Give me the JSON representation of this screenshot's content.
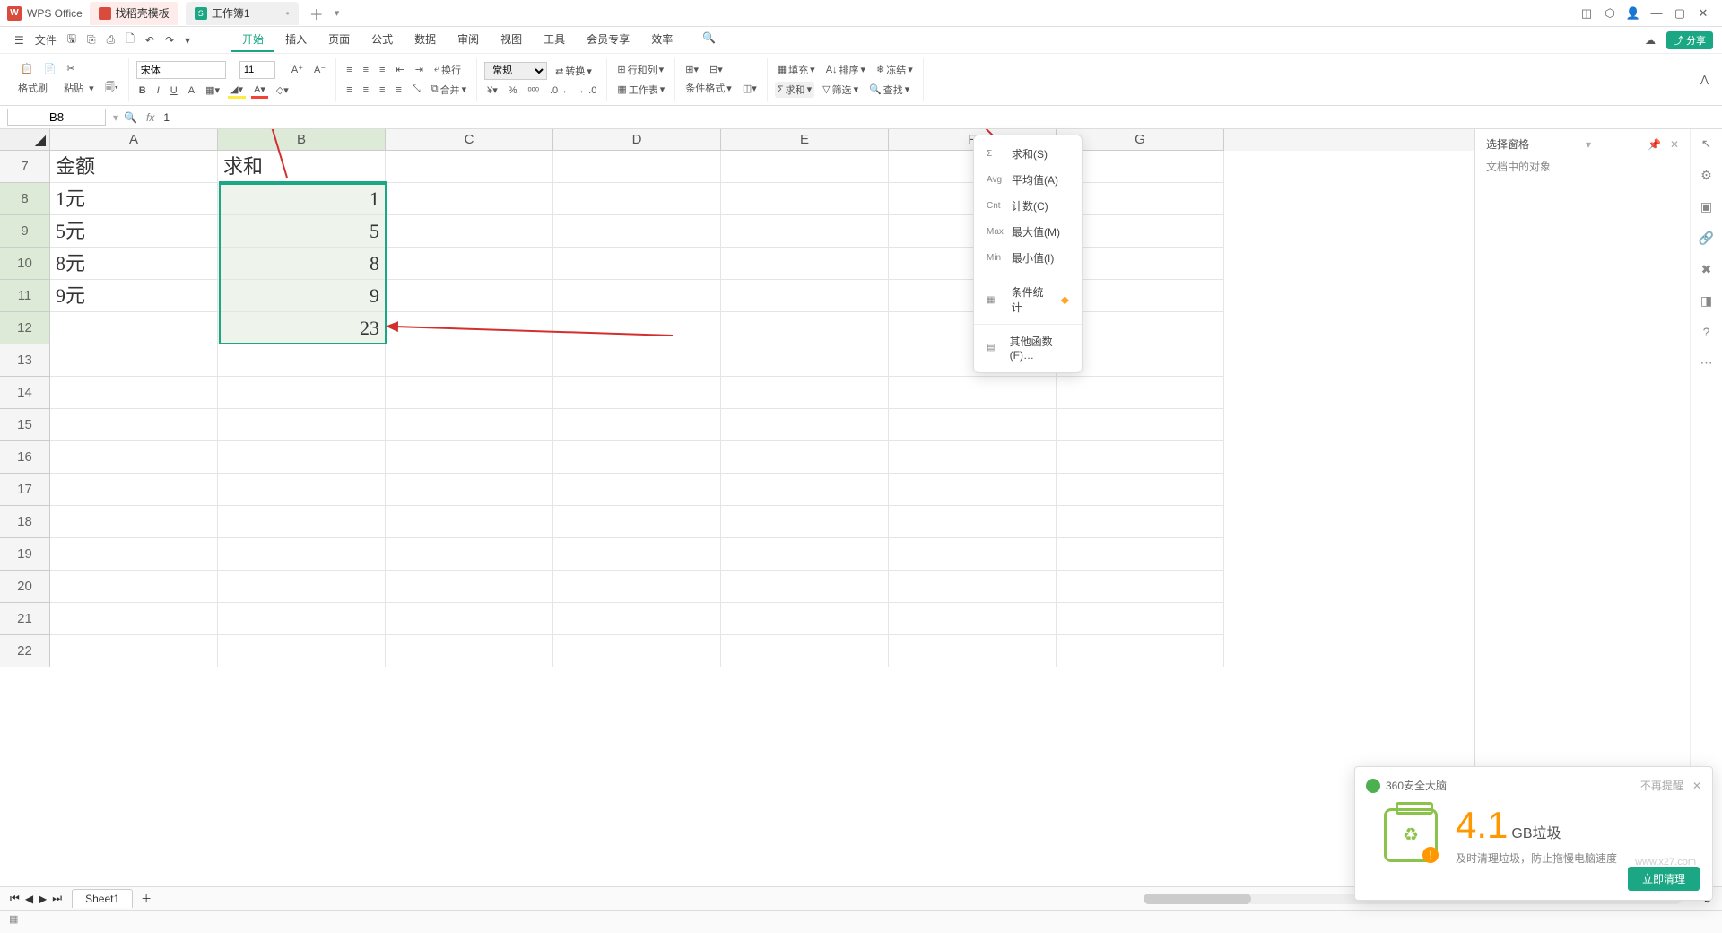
{
  "titlebar": {
    "app": "WPS Office",
    "tab1": "找稻壳模板",
    "tab2": "工作簿1",
    "tab2_icon": "S"
  },
  "menubar": {
    "file": "文件",
    "tabs": [
      "开始",
      "插入",
      "页面",
      "公式",
      "数据",
      "审阅",
      "视图",
      "工具",
      "会员专享",
      "效率"
    ],
    "share": "分享"
  },
  "toolbar": {
    "format_brush": "格式刷",
    "paste": "粘贴",
    "font": "宋体",
    "size": "11",
    "general": "常规",
    "convert": "转换",
    "rowcol": "行和列",
    "worksheet": "工作表",
    "cond_fmt": "条件格式",
    "fill": "填充",
    "sort": "排序",
    "freeze": "冻结",
    "sum": "求和",
    "filter": "筛选",
    "find": "查找",
    "wrap": "换行",
    "merge": "合并"
  },
  "namebox": {
    "cell": "B8",
    "formula": "1"
  },
  "columns": [
    "A",
    "B",
    "C",
    "D",
    "E",
    "F",
    "G"
  ],
  "rows": [
    7,
    8,
    9,
    10,
    11,
    12,
    13,
    14,
    15,
    16,
    17,
    18,
    19,
    20,
    21,
    22
  ],
  "cells": {
    "A7": "金额",
    "B7": "求和",
    "A8": "1元",
    "B8": "1",
    "A9": "5元",
    "B9": "5",
    "A10": "8元",
    "B10": "8",
    "A11": "9元",
    "B11": "9",
    "B12": "23"
  },
  "dropdown": {
    "sum": "求和(S)",
    "avg": "平均值(A)",
    "cnt": "计数(C)",
    "max": "最大值(M)",
    "min": "最小值(I)",
    "cond": "条件统计",
    "other": "其他函数(F)…",
    "i_sum": "Σ",
    "i_avg": "Avg",
    "i_cnt": "Cnt",
    "i_max": "Max",
    "i_min": "Min"
  },
  "side": {
    "title": "选择窗格",
    "sub": "文档中的对象"
  },
  "sheet": "Sheet1",
  "popup": {
    "title": "360安全大脑",
    "close": "不再提醒",
    "num": "4.1",
    "unit": "GB垃圾",
    "sub": "及时清理垃圾，防止拖慢电脑速度",
    "btn": "立即清理",
    "watermark": "www.x27.com"
  }
}
